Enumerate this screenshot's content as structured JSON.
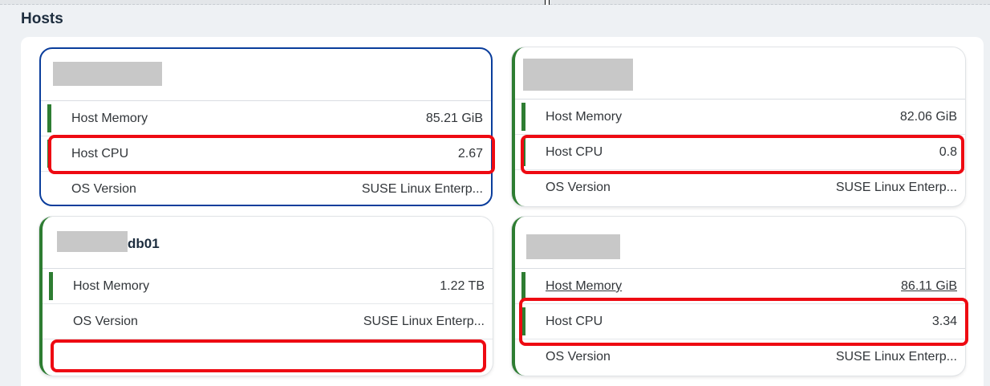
{
  "section": {
    "title": "Hosts"
  },
  "cards": [
    {
      "title": "",
      "rows": [
        {
          "label": "Host Memory",
          "value": "85.21 GiB"
        },
        {
          "label": "Host CPU",
          "value": "2.67"
        },
        {
          "label": "OS Version",
          "value": "SUSE Linux Enterp..."
        }
      ]
    },
    {
      "title": "",
      "rows": [
        {
          "label": "Host Memory",
          "value": "82.06 GiB"
        },
        {
          "label": "Host CPU",
          "value": "0.8"
        },
        {
          "label": "OS Version",
          "value": "SUSE Linux Enterp..."
        }
      ]
    },
    {
      "title": "db01",
      "rows": [
        {
          "label": "Host Memory",
          "value": "1.22 TB"
        },
        {
          "label": "OS Version",
          "value": "SUSE Linux Enterp..."
        }
      ]
    },
    {
      "title": "",
      "rows": [
        {
          "label": "Host Memory",
          "value": "86.11 GiB"
        },
        {
          "label": "Host CPU",
          "value": "3.34"
        },
        {
          "label": "OS Version",
          "value": "SUSE Linux Enterp..."
        }
      ]
    }
  ],
  "colors": {
    "accent_green": "#2e7d32",
    "selected_border": "#0a3d9c",
    "highlight_red": "#ee0a12",
    "redaction_gray": "#c8c8c8"
  }
}
